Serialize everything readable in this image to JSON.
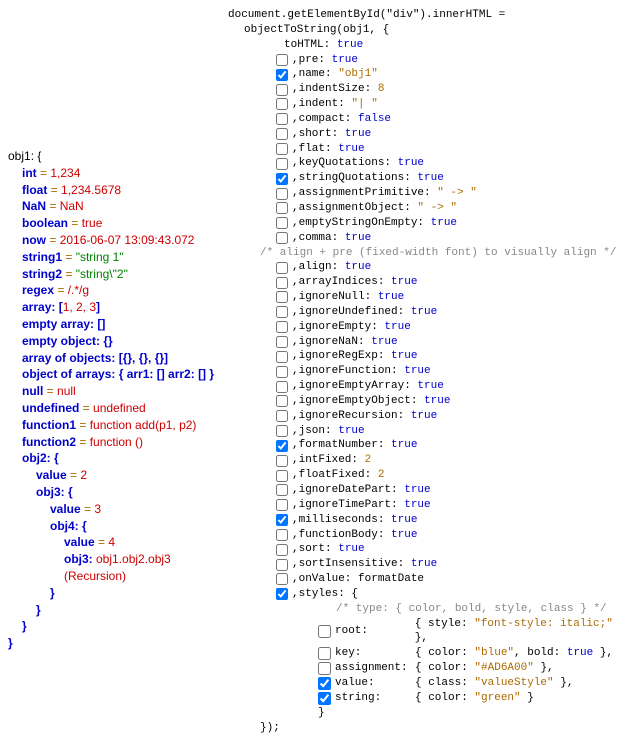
{
  "left": {
    "root": "obj1: {",
    "lines": [
      {
        "k": "int",
        "v": "1,234",
        "cls": "red"
      },
      {
        "k": "float",
        "v": "1,234.5678",
        "cls": "red"
      },
      {
        "k": "NaN",
        "v": "NaN",
        "cls": "red"
      },
      {
        "k": "boolean",
        "v": "true",
        "cls": "red"
      },
      {
        "k": "now",
        "v": "2016-06-07 13:09:43.072",
        "cls": "red"
      }
    ],
    "string1_k": "string1",
    "string1_v": "\"string 1\"",
    "string2_k": "string2",
    "string2_v": "\"string\\\"2\"",
    "regex_k": "regex",
    "regex_v": "/.*/g",
    "array_l": "array: [",
    "array_v": "1, 2, 3",
    "array_r": "]",
    "empty_array": "empty array: []",
    "empty_object": "empty object: {}",
    "arr_objects": "array of objects: [{}, {}, {}]",
    "obj_arrays": "object of arrays: { arr1: [] arr2: [] }",
    "null_k": "null",
    "null_v": "null",
    "undef_k": "undefined",
    "undef_v": "undefined",
    "fn1_k": "function1",
    "fn1_v": "function add(p1, p2)",
    "fn2_k": "function2",
    "fn2_v": "function ()",
    "obj2": "obj2: {",
    "value2_k": "value",
    "value2_v": "2",
    "obj3": "obj3: {",
    "value3_k": "value",
    "value3_v": "3",
    "obj4": "obj4: {",
    "value4_k": "value",
    "value4_v": "4",
    "recur_k": "obj3: ",
    "recur_v": "obj1.obj2.obj3 (Recursion)",
    "close": "}"
  },
  "header": {
    "l1": "document.getElementById(\"div\").innerHTML =",
    "l2": "objectToString(obj1, {",
    "l3": "toHTML: ",
    "l3v": "true"
  },
  "opts": [
    {
      "cb": false,
      "pre": ",pre: ",
      "val": "true"
    },
    {
      "cb": true,
      "pre": ",name: ",
      "str": "\"obj1\""
    },
    {
      "cb": false,
      "pre": ",indentSize: ",
      "num": "8"
    },
    {
      "cb": false,
      "pre": ",indent: ",
      "str": "\"|  \""
    },
    {
      "cb": false,
      "pre": ",compact: ",
      "val": "false"
    },
    {
      "cb": false,
      "pre": ",short: ",
      "val": "true"
    },
    {
      "cb": false,
      "pre": ",flat: ",
      "val": "true"
    },
    {
      "cb": false,
      "pre": ",keyQuotations: ",
      "val": "true"
    },
    {
      "cb": true,
      "pre": ",stringQuotations: ",
      "val": "true"
    },
    {
      "cb": false,
      "pre": ",assignmentPrimitive: ",
      "str": "\" -> \""
    },
    {
      "cb": false,
      "pre": ",assignmentObject: ",
      "str": "\" -> \""
    },
    {
      "cb": false,
      "pre": ",emptyStringOnEmpty: ",
      "val": "true"
    },
    {
      "cb": false,
      "pre": ",comma: ",
      "val": "true"
    }
  ],
  "comment_align": "/* align + pre (fixed-width font) to visually align */",
  "opts2": [
    {
      "cb": false,
      "pre": ",align: ",
      "val": "true"
    },
    {
      "cb": false,
      "pre": ",arrayIndices: ",
      "val": "true"
    },
    {
      "cb": false,
      "pre": ",ignoreNull: ",
      "val": "true"
    },
    {
      "cb": false,
      "pre": ",ignoreUndefined: ",
      "val": "true"
    },
    {
      "cb": false,
      "pre": ",ignoreEmpty: ",
      "val": "true"
    },
    {
      "cb": false,
      "pre": ",ignoreNaN: ",
      "val": "true"
    },
    {
      "cb": false,
      "pre": ",ignoreRegExp: ",
      "val": "true"
    },
    {
      "cb": false,
      "pre": ",ignoreFunction: ",
      "val": "true"
    },
    {
      "cb": false,
      "pre": ",ignoreEmptyArray: ",
      "val": "true"
    },
    {
      "cb": false,
      "pre": ",ignoreEmptyObject: ",
      "val": "true"
    },
    {
      "cb": false,
      "pre": ",ignoreRecursion: ",
      "val": "true"
    },
    {
      "cb": false,
      "pre": ",json: ",
      "val": "true"
    },
    {
      "cb": true,
      "pre": ",formatNumber: ",
      "val": "true"
    },
    {
      "cb": false,
      "pre": ",intFixed: ",
      "num": "2"
    },
    {
      "cb": false,
      "pre": ",floatFixed: ",
      "num": "2"
    },
    {
      "cb": false,
      "pre": ",ignoreDatePart: ",
      "val": "true"
    },
    {
      "cb": false,
      "pre": ",ignoreTimePart: ",
      "val": "true"
    },
    {
      "cb": true,
      "pre": ",milliseconds: ",
      "val": "true"
    },
    {
      "cb": false,
      "pre": ",functionBody: ",
      "val": "true"
    },
    {
      "cb": false,
      "pre": ",sort: ",
      "val": "true"
    },
    {
      "cb": false,
      "pre": ",sortInsensitive: ",
      "val": "true"
    },
    {
      "cb": false,
      "pre": ",onValue: ",
      "plain": "formatDate"
    },
    {
      "cb": true,
      "pre": ",styles: {",
      "val": ""
    }
  ],
  "styles": {
    "comment": "/* type:        { color, bold, style, class } */",
    "rows": [
      {
        "cb": false,
        "label": "root:",
        "body": "{ style: ",
        "str": "\"font-style: italic;\"",
        "tail": " },"
      },
      {
        "cb": false,
        "label": "key:",
        "body": "{ color: ",
        "str": "\"blue\"",
        "mid": ", bold: ",
        "val": "true",
        "tail": " },"
      },
      {
        "cb": false,
        "label": "assignment:",
        "body": "{ color: ",
        "str": "\"#AD6A00\"",
        "tail": " },"
      },
      {
        "cb": true,
        "label": "value:",
        "body": "{ class: ",
        "str": "\"valueStyle\"",
        "tail": " },"
      },
      {
        "cb": true,
        "label": "string:",
        "body": "{ color: ",
        "str": "\"green\"",
        "tail": " }"
      }
    ],
    "close1": "}",
    "close2": "});"
  }
}
